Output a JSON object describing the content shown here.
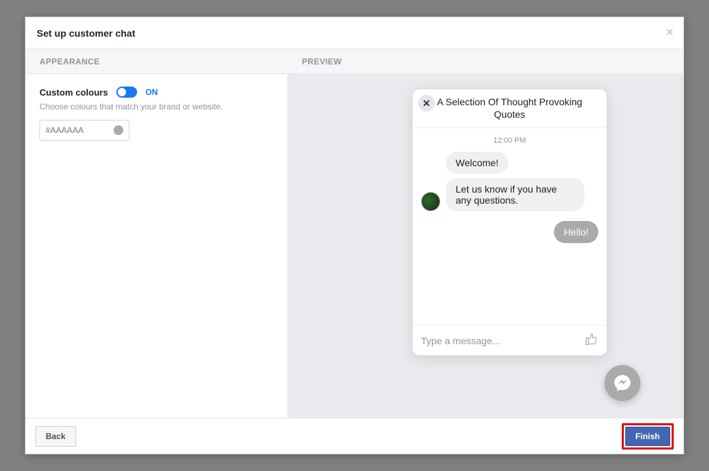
{
  "modal": {
    "title": "Set up customer chat"
  },
  "tabs": {
    "appearance": "APPEARANCE",
    "preview": "PREVIEW"
  },
  "appearance": {
    "custom_colours_label": "Custom colours",
    "toggle_state": "ON",
    "description": "Choose colours that match your brand or website.",
    "hex_placeholder": "#AAAAAA",
    "swatch": "#AAAAAA"
  },
  "preview": {
    "chat_title": "A Selection Of Thought Provoking Quotes",
    "timestamp": "12:00 PM",
    "messages": {
      "in1": "Welcome!",
      "in2": "Let us know if you have any questions.",
      "out1": "Hello!"
    },
    "input_placeholder": "Type a message..."
  },
  "footer": {
    "back": "Back",
    "finish": "Finish"
  },
  "colors": {
    "accent": "#AAAAAA"
  }
}
